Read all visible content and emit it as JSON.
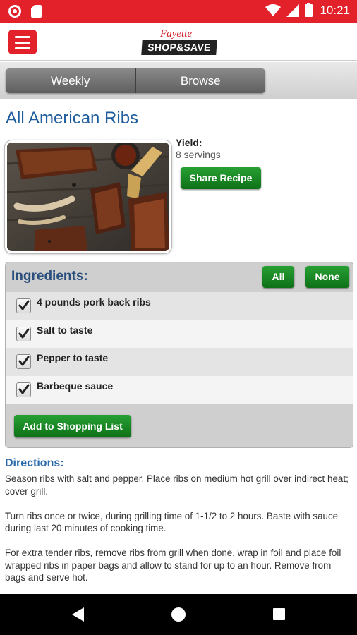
{
  "status_bar": {
    "time": "10:21",
    "icons": [
      "record-icon",
      "sim-card-icon",
      "wifi-icon",
      "signal-icon",
      "battery-icon"
    ]
  },
  "header": {
    "logo_top": "Fayette",
    "logo_main": "SHOP&SAVE",
    "menu_icon": "hamburger-icon"
  },
  "tabs": [
    {
      "label": "Weekly"
    },
    {
      "label": "Browse"
    }
  ],
  "recipe": {
    "title": "All American Ribs",
    "yield_label": "Yield:",
    "yield_value": "8 servings",
    "share_label": "Share Recipe"
  },
  "ingredients": {
    "heading": "Ingredients:",
    "all_label": "All",
    "none_label": "None",
    "items": [
      {
        "text": "4 pounds pork back ribs",
        "checked": true
      },
      {
        "text": "Salt to taste",
        "checked": true
      },
      {
        "text": "Pepper to taste",
        "checked": true
      },
      {
        "text": "Barbeque sauce",
        "checked": true
      }
    ],
    "add_label": "Add to Shopping List"
  },
  "directions": {
    "heading": "Directions:",
    "paragraphs": [
      "Season ribs with salt and pepper. Place ribs on medium hot grill over indirect heat; cover grill.",
      "Turn ribs once or twice, during grilling time of 1-1/2 to 2 hours. Baste with sauce during last 20 minutes of cooking time.",
      "For extra tender ribs, remove ribs from grill when done, wrap in foil and place foil wrapped ribs in paper bags and allow to stand for up to an hour. Remove from bags and serve hot."
    ]
  },
  "colors": {
    "brand_red": "#e2212b",
    "title_blue": "#1f5d9c",
    "button_green": "#1a8a25"
  }
}
